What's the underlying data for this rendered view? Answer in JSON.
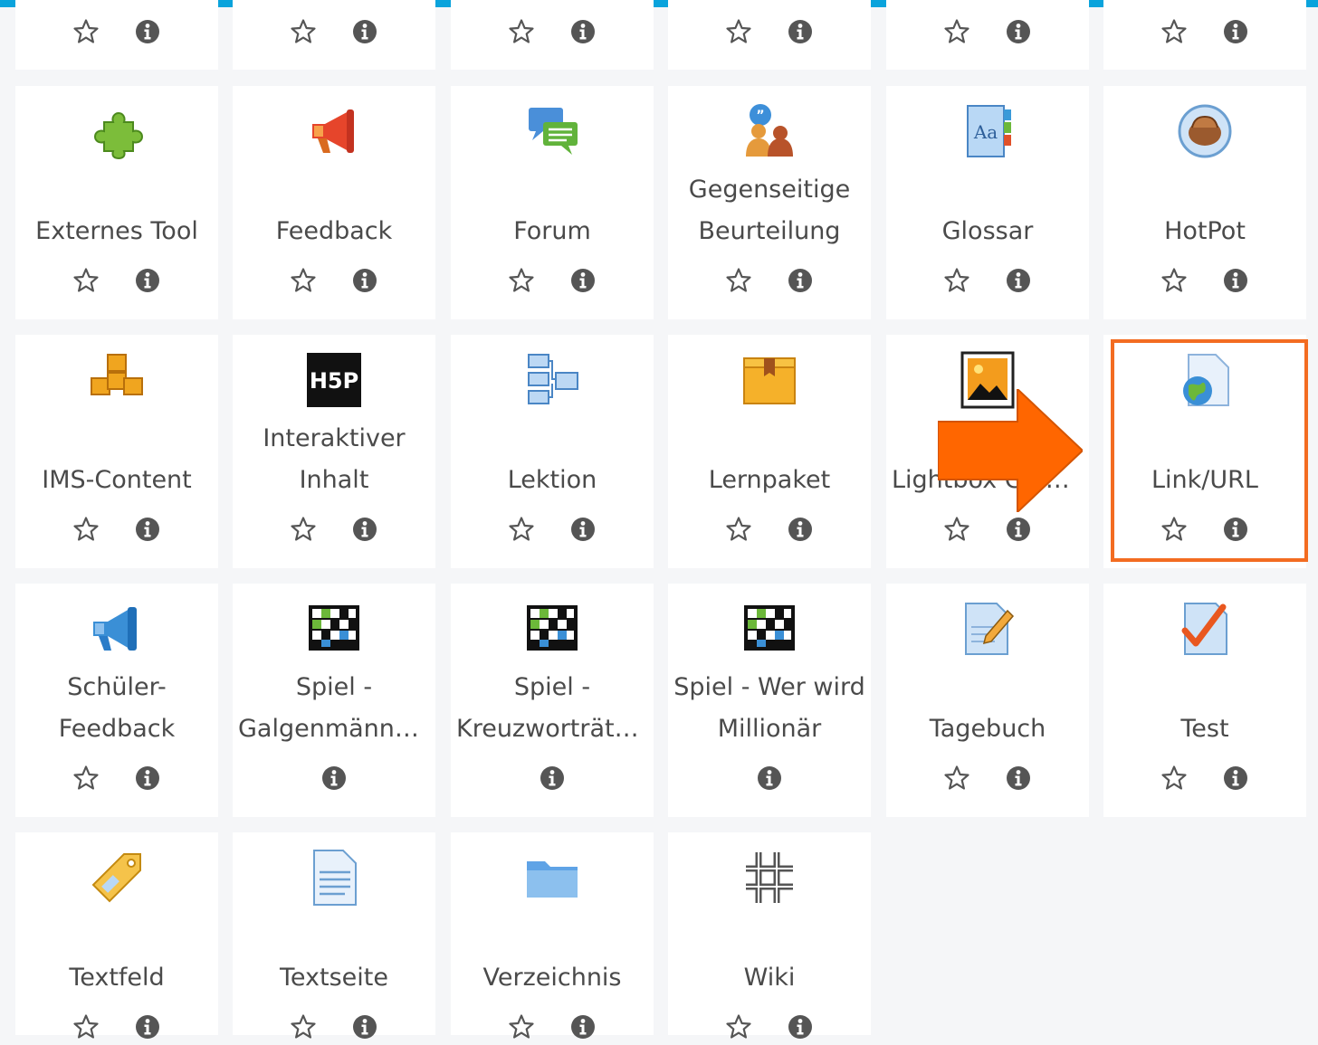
{
  "theme": {
    "accent": "#0aa3dc",
    "highlight": "#f36c21",
    "arrow": "#ff6600",
    "text": "#4a4a4a"
  },
  "top_row_partial": [
    {
      "star_icon": "star-outline-icon",
      "info_icon": "info-icon"
    },
    {
      "star_icon": "star-outline-icon",
      "info_icon": "info-icon"
    },
    {
      "star_icon": "star-outline-icon",
      "info_icon": "info-icon"
    },
    {
      "star_icon": "star-outline-icon",
      "info_icon": "info-icon"
    },
    {
      "star_icon": "star-outline-icon",
      "info_icon": "info-icon"
    },
    {
      "star_icon": "star-outline-icon",
      "info_icon": "info-icon"
    }
  ],
  "modules": [
    {
      "id": "externes-tool",
      "icon": "puzzle-icon",
      "lines": [
        "Externes Tool"
      ],
      "star": true
    },
    {
      "id": "feedback",
      "icon": "megaphone-icon",
      "lines": [
        "Feedback"
      ],
      "star": true
    },
    {
      "id": "forum",
      "icon": "forum-icon",
      "lines": [
        "Forum"
      ],
      "star": true
    },
    {
      "id": "gegenseitige-beurteilung",
      "icon": "peer-review-icon",
      "lines": [
        "Gegenseitige",
        "Beurteilung"
      ],
      "star": true
    },
    {
      "id": "glossar",
      "icon": "glossary-icon",
      "lines": [
        "Glossar"
      ],
      "star": true
    },
    {
      "id": "hotpot",
      "icon": "hotpot-icon",
      "lines": [
        "HotPot"
      ],
      "star": true
    },
    {
      "id": "ims-content",
      "icon": "ims-boxes-icon",
      "lines": [
        "IMS-Content"
      ],
      "star": true
    },
    {
      "id": "interaktiver-inhalt",
      "icon": "h5p-icon",
      "lines": [
        "Interaktiver",
        "Inhalt"
      ],
      "star": true
    },
    {
      "id": "lektion",
      "icon": "lesson-icon",
      "lines": [
        "Lektion"
      ],
      "star": true
    },
    {
      "id": "lernpaket",
      "icon": "package-icon",
      "lines": [
        "Lernpaket"
      ],
      "star": true
    },
    {
      "id": "lightbox-galerie",
      "icon": "image-gallery-icon",
      "lines": [
        "Lightbox Galerie"
      ],
      "star": true
    },
    {
      "id": "link-url",
      "icon": "url-globe-icon",
      "lines": [
        "Link/URL"
      ],
      "star": true
    },
    {
      "id": "schueler-feedback",
      "icon": "student-feedback-icon",
      "lines": [
        "Schüler-",
        "Feedback"
      ],
      "star": true
    },
    {
      "id": "spiel-galgenmaennchen",
      "icon": "game-grid-icon",
      "lines": [
        "Spiel -",
        "Galgenmännc…"
      ],
      "star": false
    },
    {
      "id": "spiel-kreuzwortraetsel",
      "icon": "game-grid-icon",
      "lines": [
        "Spiel -",
        "Kreuzworträtsel"
      ],
      "star": false
    },
    {
      "id": "spiel-millionaer",
      "icon": "game-grid-icon",
      "lines": [
        "Spiel - Wer wird",
        "Millionär"
      ],
      "star": false
    },
    {
      "id": "tagebuch",
      "icon": "journal-pencil-icon",
      "lines": [
        "Tagebuch"
      ],
      "star": true
    },
    {
      "id": "test",
      "icon": "quiz-check-icon",
      "lines": [
        "Test"
      ],
      "star": true
    },
    {
      "id": "textfeld",
      "icon": "label-tag-icon",
      "lines": [
        "Textfeld"
      ],
      "star": true
    },
    {
      "id": "textseite",
      "icon": "text-page-icon",
      "lines": [
        "Textseite"
      ],
      "star": true
    },
    {
      "id": "verzeichnis",
      "icon": "folder-icon",
      "lines": [
        "Verzeichnis"
      ],
      "star": true
    },
    {
      "id": "wiki",
      "icon": "wiki-icon",
      "lines": [
        "Wiki"
      ],
      "star": true
    }
  ],
  "annotation": {
    "highlighted_module": "link-url",
    "arrow_icon": "arrow-right-icon"
  }
}
